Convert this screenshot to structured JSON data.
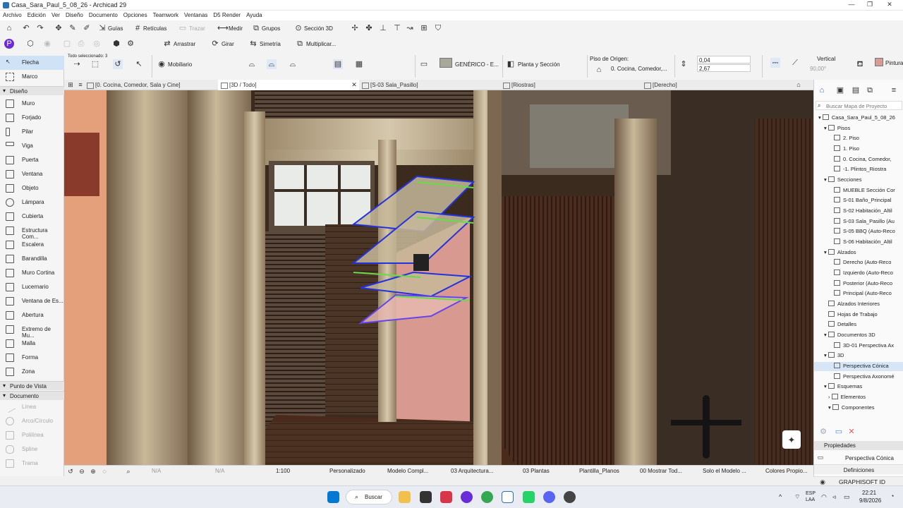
{
  "window": {
    "title": "Casa_Sara_Paul_5_08_26 - Archicad 29"
  },
  "menu": [
    "Archivo",
    "Edición",
    "Ver",
    "Diseño",
    "Documento",
    "Opciones",
    "Teamwork",
    "Ventanas",
    "D5 Render",
    "Ayuda"
  ],
  "toolbar": {
    "guias": "Guías",
    "reticulas": "Retículas",
    "trazar": "Trazar",
    "medir": "Medir",
    "grupos": "Grupos",
    "seccion3d": "Sección 3D",
    "arrastrar": "Arrastrar",
    "girar": "Girar",
    "simetria": "Simetría",
    "multiplicar": "Multiplicar..."
  },
  "infobox": {
    "selected": "Todo seleccionado: 3",
    "mobiliario": "Mobiliario",
    "material": "GENÉRICO - E...",
    "planta": "Planta y Sección",
    "piso_label": "Piso de Origen:",
    "piso_value": "0. Cocina, Comedor,...",
    "val1": "0,04",
    "val2": "2,67",
    "vertical": "Vertical",
    "angle": "90,00°",
    "pintura": "Pintura"
  },
  "left_panel": {
    "flecha": "Flecha",
    "marco": "Marco",
    "diseno": "Diseño",
    "tools": [
      "Muro",
      "Forjado",
      "Pilar",
      "Viga",
      "Puerta",
      "Ventana",
      "Objeto",
      "Lámpara",
      "Cubierta",
      "Estructura Com...",
      "Escalera",
      "Barandilla",
      "Muro Cortina",
      "Lucernario",
      "Ventana de Es...",
      "Abertura",
      "Extremo de Mu...",
      "Malla",
      "Forma",
      "Zona"
    ],
    "punto_vista": "Punto de Vista",
    "documento": "Documento",
    "doc_tools": [
      "Línea",
      "Arco/Círculo",
      "Polilínea",
      "Spline",
      "Trama"
    ]
  },
  "tabs": [
    {
      "label": "[0. Cocina, Comedor, Sala y Cine]"
    },
    {
      "label": "[3D / Todo]"
    },
    {
      "label": "[S-03 Sala_Pasillo]"
    },
    {
      "label": "[Riostras]"
    },
    {
      "label": "[Derecho]"
    }
  ],
  "status": {
    "na1": "N/A",
    "na2": "N/A",
    "scale": "1:100",
    "pers": "Personalizado",
    "modelo": "Modelo Compl...",
    "arq": "03 Arquitectura...",
    "plantas": "03 Plantas",
    "plantilla": "Plantilla_Planos",
    "mostrar": "00 Mostrar Tod...",
    "solo": "Solo el Modelo ...",
    "colores": "Colores Propio..."
  },
  "navigator": {
    "search": "Buscar Mapa de Proyecto",
    "project": "Casa_Sara_Paul_5_08_26",
    "pisos": "Pisos",
    "piso_items": [
      "2. Piso",
      "1. Piso",
      "0. Cocina, Comedor,",
      "-1. Plintos_Riostra"
    ],
    "secciones": "Secciones",
    "seccion_items": [
      "MUEBLE Sección Cor",
      "S-01 Baño_Principal",
      "S-02 Habitación_Altil",
      "S-03 Sala_Pasillo (Au",
      "S-05 BBQ (Auto-Reco",
      "S-06 Habitación_Altil"
    ],
    "alzados": "Alzados",
    "alzado_items": [
      "Derecho (Auto-Reco",
      "Izquierdo (Auto-Reco",
      "Posterior (Auto-Reco",
      "Principal (Auto-Reco"
    ],
    "alzados_int": "Alzados Interiores",
    "hojas": "Hojas de Trabajo",
    "detalles": "Detalles",
    "docs3d": "Documentos 3D",
    "doc3d_item": "3D-01 Perspectiva Ax",
    "n3d": "3D",
    "pers_conica": "Perspectiva Cónica",
    "pers_axo": "Perspectiva Axonomé",
    "esquemas": "Esquemas",
    "elementos": "Elementos",
    "componentes": "Componentes",
    "propiedades": "Propiedades",
    "prop_value": "Perspectiva Cónica",
    "definiciones": "Definiciones",
    "graphisoft": "GRAPHISOFT ID"
  },
  "taskbar": {
    "search": "Buscar",
    "lang1": "ESP",
    "lang2": "LAA",
    "time": "22:21",
    "date": "9/8/2026"
  },
  "colors": {
    "accent": "#0078d4",
    "pink_wall": "#d89a90",
    "wood": "#5a4030"
  }
}
